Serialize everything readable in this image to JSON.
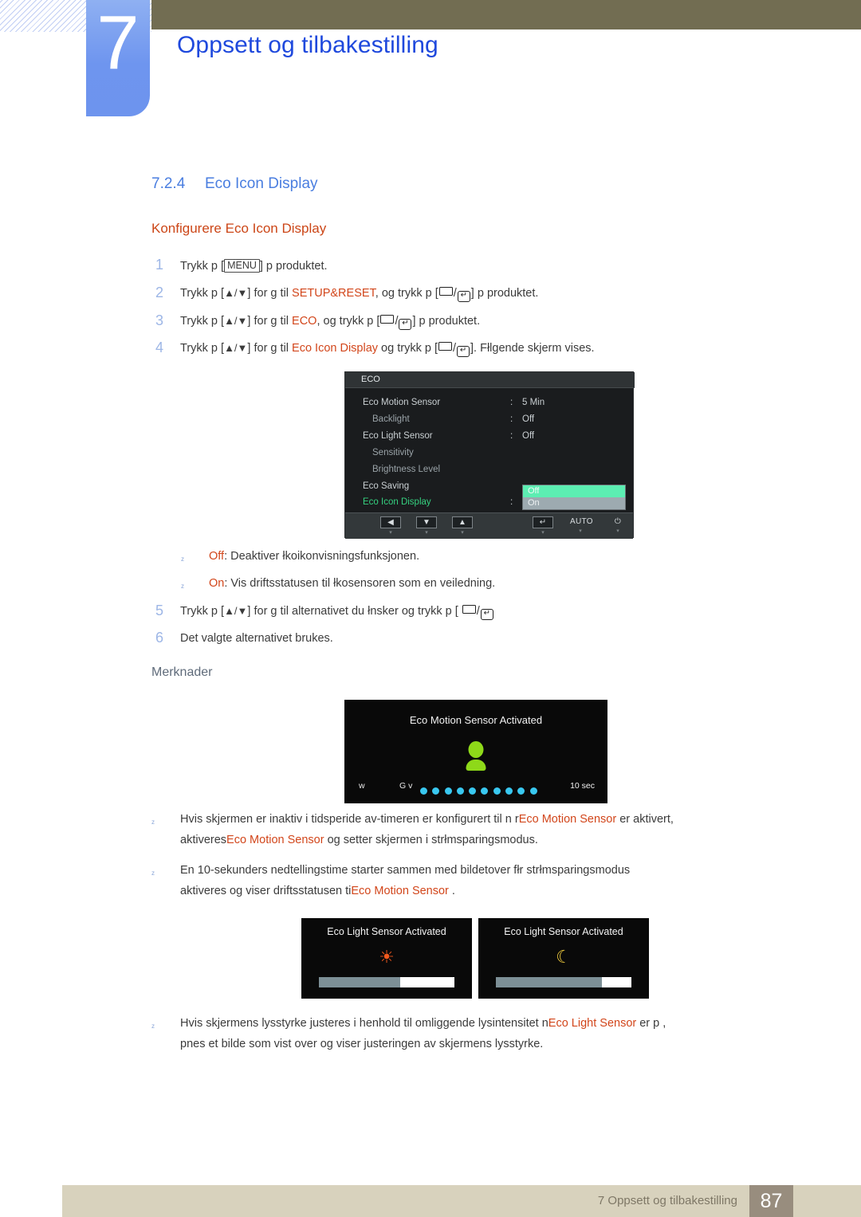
{
  "header": {
    "chapter_number": "7",
    "chapter_title": "Oppsett og tilbakestilling"
  },
  "section": {
    "number": "7.2.4",
    "title": "Eco Icon Display",
    "subtitle": "Konfigurere Eco Icon Display"
  },
  "steps": [
    {
      "n": "1",
      "parts": [
        {
          "t": "Trykk p  [",
          "c": "body"
        },
        {
          "t": "MENU",
          "c": "key"
        },
        {
          "t": "] p  produktet.",
          "c": "body"
        }
      ]
    },
    {
      "n": "2",
      "parts": [
        {
          "t": "Trykk p  [",
          "c": "body"
        },
        {
          "t": "▲/▼",
          "c": "sym"
        },
        {
          "t": "] for   g  til  ",
          "c": "body"
        },
        {
          "t": "SETUP&RESET",
          "c": "orange"
        },
        {
          "t": ", og trykk p  [",
          "c": "body"
        },
        {
          "t": "RECT/ENTER",
          "c": "icon"
        },
        {
          "t": "] p  produktet.",
          "c": "body"
        }
      ]
    },
    {
      "n": "3",
      "parts": [
        {
          "t": "Trykk p  [",
          "c": "body"
        },
        {
          "t": "▲/▼",
          "c": "sym"
        },
        {
          "t": "] for   g  til  ",
          "c": "body"
        },
        {
          "t": "ECO",
          "c": "orange"
        },
        {
          "t": ", og trykk p  [",
          "c": "body"
        },
        {
          "t": "RECT/ENTER",
          "c": "icon"
        },
        {
          "t": "] p  produktet.",
          "c": "body"
        }
      ]
    },
    {
      "n": "4",
      "parts": [
        {
          "t": "Trykk p  [",
          "c": "body"
        },
        {
          "t": "▲/▼",
          "c": "sym"
        },
        {
          "t": "] for   g  til  ",
          "c": "body"
        },
        {
          "t": "Eco Icon Display",
          "c": "orange"
        },
        {
          "t": "  og trykk p  [",
          "c": "body"
        },
        {
          "t": "RECT/ENTER",
          "c": "icon"
        },
        {
          "t": "]. Fłlgende skjerm vises.",
          "c": "body"
        }
      ]
    }
  ],
  "osd": {
    "title": "ECO",
    "rows": [
      {
        "label": "Eco Motion Sensor",
        "indent": false,
        "colon": ":",
        "value": "5 Min",
        "dim": false
      },
      {
        "label": "Backlight",
        "indent": true,
        "colon": ":",
        "value": "Off",
        "dim": false
      },
      {
        "label": "Eco Light Sensor",
        "indent": false,
        "colon": ":",
        "value": "Off",
        "dim": false
      },
      {
        "label": "Sensitivity",
        "indent": true,
        "colon": "",
        "value": "",
        "dim": true
      },
      {
        "label": "Brightness Level",
        "indent": true,
        "colon": "",
        "value": "",
        "dim": true
      },
      {
        "label": "Eco Saving",
        "indent": false,
        "colon": "",
        "value": "",
        "dim": false
      },
      {
        "label": "Eco Icon Display",
        "indent": false,
        "colon": ":",
        "value": "",
        "dim": false,
        "highlight": true
      }
    ],
    "dropdown": {
      "selected": "Off",
      "other": "On",
      "selected_color": "#5ceeb2",
      "other_color": "#9daab0"
    },
    "footer_buttons": [
      {
        "glyph": "◀",
        "sub": "▾",
        "type": "key"
      },
      {
        "glyph": "▼",
        "sub": "▾",
        "type": "key"
      },
      {
        "glyph": "▲",
        "sub": "▾",
        "type": "key"
      },
      {
        "glyph": "↵",
        "sub": "▾",
        "type": "key"
      },
      {
        "glyph": "AUTO",
        "sub": "▾",
        "type": "text"
      },
      {
        "glyph": "⏻",
        "sub": "▾",
        "type": "text"
      }
    ]
  },
  "option_notes": [
    {
      "term": "Off",
      "rest": ": Deaktiver łkoikonvisningsfunksjonen."
    },
    {
      "term": "On",
      "rest": ": Vis driftsstatusen til łkosensoren som en veiledning."
    }
  ],
  "steps_tail": [
    {
      "n": "5",
      "parts": [
        {
          "t": "Trykk p  [",
          "c": "body"
        },
        {
          "t": "▲/▼",
          "c": "sym"
        },
        {
          "t": "] for   g  til alternativet du łnsker og trykk p  [ ",
          "c": "body"
        },
        {
          "t": "RECT/ENTER",
          "c": "icon"
        }
      ]
    },
    {
      "n": "6",
      "parts": [
        {
          "t": "Det valgte alternativet brukes.",
          "c": "body"
        }
      ]
    }
  ],
  "notes_heading": "Merknader",
  "motion_popup": {
    "title": "Eco Motion Sensor Activated",
    "left_label": "w",
    "mid_label": "G v",
    "right_label": "10 sec",
    "dot_count": 10,
    "dot_color": "#39c8f0",
    "person_color": "#8ed919"
  },
  "notes": [
    {
      "lines": [
        [
          {
            "t": "Hvis skjermen er inaktiv i tidsperid",
            "c": "body"
          },
          {
            "t": "e av-timeren er konfigurert til n r",
            "c": "body"
          },
          {
            "t": "Eco Motion Sensor",
            "c": "orange"
          },
          {
            "t": " er aktivert,",
            "c": "body"
          }
        ],
        [
          {
            "t": "aktiveres",
            "c": "body"
          },
          {
            "t": "Eco Motion Sensor",
            "c": "orange"
          },
          {
            "t": "  og setter skjermen i strłmsparingsmodus.",
            "c": "body"
          }
        ]
      ]
    },
    {
      "lines": [
        [
          {
            "t": "En 10-sekunders nedtellingstim",
            "c": "body"
          },
          {
            "t": "e starter sammen med bildet",
            "c": "body"
          },
          {
            "t": "over fłr strłmsparingsmodus",
            "c": "body"
          }
        ],
        [
          {
            "t": "aktiveres og viser driftsstatusen ti",
            "c": "body"
          },
          {
            "t": "Eco Motion Sensor",
            "c": "orange"
          },
          {
            "t": " .",
            "c": "body"
          }
        ]
      ]
    }
  ],
  "light_popups": [
    {
      "title": "Eco Light Sensor Activated",
      "icon": "☀",
      "icon_kind": "sun",
      "fill_pct": 60
    },
    {
      "title": "Eco Light Sensor Activated",
      "icon": "☾",
      "icon_kind": "moon",
      "fill_pct": 78
    }
  ],
  "final_note": {
    "lines": [
      [
        {
          "t": "Hvis skjermens lysstyrke justeres i henhold til omliggende lysintensitet n",
          "c": "body"
        },
        {
          "t": "Eco Light Sensor",
          "c": "orange"
        },
        {
          "t": "  er p ,",
          "c": "body"
        }
      ],
      [
        {
          "t": " pnes et bilde som vist over og vise",
          "c": "body"
        },
        {
          "t": "r justeringen av skjermens lysstyrke.",
          "c": "body"
        }
      ]
    ]
  },
  "footer": {
    "text": "7 Oppsett og tilbakestilling",
    "page": "87"
  }
}
